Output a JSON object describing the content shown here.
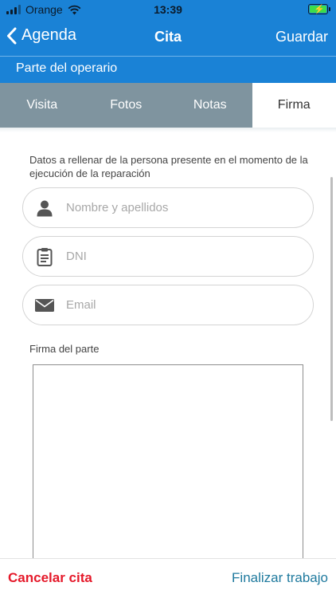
{
  "status_bar": {
    "carrier": "Orange",
    "time": "13:39",
    "icons": [
      "signal-icon",
      "wifi-icon",
      "battery-charging-icon"
    ]
  },
  "nav": {
    "back_label": "Agenda",
    "title": "Cita",
    "save_label": "Guardar"
  },
  "section": {
    "title": "Parte del operario"
  },
  "tabs": [
    {
      "label": "Visita",
      "active": false
    },
    {
      "label": "Fotos",
      "active": false
    },
    {
      "label": "Notas",
      "active": false
    },
    {
      "label": "Firma",
      "active": true
    }
  ],
  "form": {
    "instructions": "Datos a rellenar de la persona presente en el momento de la ejecución de la reparación",
    "name_field": {
      "placeholder": "Nombre y apellidos",
      "value": "",
      "icon": "person-icon"
    },
    "dni_field": {
      "placeholder": "DNI",
      "value": "",
      "icon": "clipboard-icon"
    },
    "email_field": {
      "placeholder": "Email",
      "value": "",
      "icon": "envelope-icon"
    },
    "signature_label": "Firma del parte"
  },
  "bottom": {
    "cancel_label": "Cancelar cita",
    "finish_label": "Finalizar trabajo"
  },
  "colors": {
    "primary": "#1a82d6",
    "tab_bar": "#7f949f",
    "cancel": "#e5192a",
    "finish": "#1f7a9e"
  }
}
